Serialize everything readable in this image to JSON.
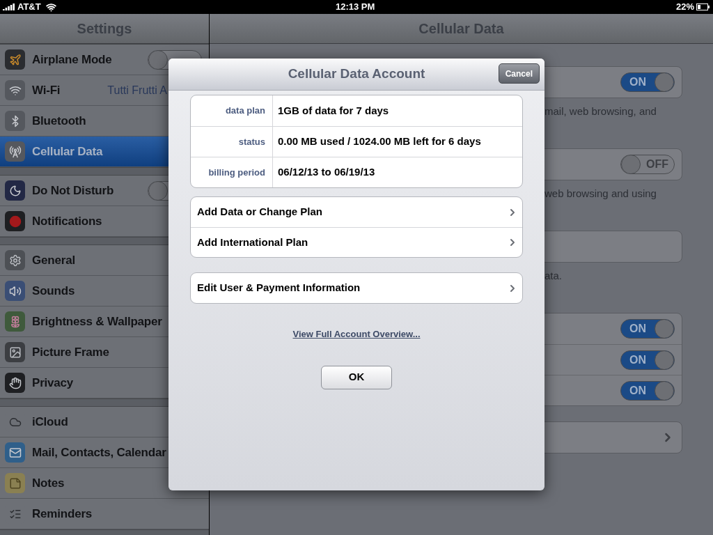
{
  "status_bar": {
    "carrier": "AT&T",
    "time": "12:13 PM",
    "battery": "22%"
  },
  "sidebar": {
    "title": "Settings",
    "groups": [
      [
        {
          "label": "Airplane Mode",
          "on": false,
          "selected": false
        },
        {
          "label": "Wi-Fi",
          "value": "Tutti Frutti A",
          "selected": false
        },
        {
          "label": "Bluetooth",
          "selected": false
        },
        {
          "label": "Cellular Data",
          "selected": true
        }
      ],
      [
        {
          "label": "Do Not Disturb",
          "on": false,
          "selected": false
        },
        {
          "label": "Notifications",
          "selected": false
        }
      ],
      [
        {
          "label": "General",
          "selected": false
        },
        {
          "label": "Sounds",
          "selected": false
        },
        {
          "label": "Brightness & Wallpaper",
          "selected": false
        },
        {
          "label": "Picture Frame",
          "selected": false
        },
        {
          "label": "Privacy",
          "selected": false
        }
      ],
      [
        {
          "label": "iCloud",
          "selected": false
        },
        {
          "label": "Mail, Contacts, Calendar",
          "selected": false
        },
        {
          "label": "Notes",
          "selected": false
        },
        {
          "label": "Reminders",
          "selected": false
        }
      ]
    ]
  },
  "detail": {
    "title": "Cellular Data",
    "sections": [
      {
        "rows": [
          {
            "kind": "switch",
            "on": true,
            "switch_label": "ON"
          }
        ],
        "footer": "mail, web browsing, and"
      },
      {
        "rows": [
          {
            "kind": "switch",
            "on": false,
            "switch_label": "OFF"
          }
        ],
        "footer": "web browsing and using"
      },
      {
        "rows": [
          {
            "kind": "blank"
          }
        ],
        "footer": "ata."
      },
      {
        "rows": [
          {
            "kind": "switch",
            "on": true,
            "switch_label": "ON"
          },
          {
            "kind": "switch",
            "on": true,
            "switch_label": "ON"
          },
          {
            "kind": "switch",
            "on": true,
            "switch_label": "ON"
          }
        ]
      },
      {
        "rows": [
          {
            "kind": "link"
          }
        ]
      }
    ]
  },
  "dialog": {
    "title": "Cellular Data Account",
    "cancel": "Cancel",
    "info": [
      {
        "label": "data plan",
        "value": "1GB of data for 7 days"
      },
      {
        "label": "status",
        "value": "0.00 MB used / 1024.00 MB left for 6 days"
      },
      {
        "label": "billing period",
        "value": "06/12/13 to 06/19/13"
      }
    ],
    "action_groups": [
      [
        "Add Data or Change Plan",
        "Add International Plan"
      ],
      [
        "Edit User & Payment Information"
      ]
    ],
    "link": "View Full Account Overview...",
    "ok": "OK"
  }
}
